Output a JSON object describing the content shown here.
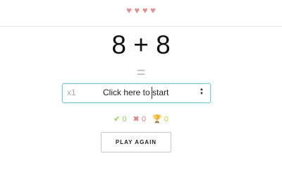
{
  "header": {
    "lives": {
      "count": 4,
      "icon": "heart-icon",
      "color": "#e88d8d"
    }
  },
  "problem": {
    "left": "8",
    "operator": "+",
    "right": "8",
    "equals": "="
  },
  "answer": {
    "multiplier": "x1",
    "start_text": "Click here to start"
  },
  "stats": {
    "correct_count": "0",
    "correct_icon": "check-icon",
    "correct_color": "#8fd14f",
    "wrong_count": "0",
    "wrong_icon": "x-icon",
    "wrong_color": "#e37f7f",
    "streak_count": "0",
    "streak_icon": "trophy-icon",
    "streak_color": "#e7c62f"
  },
  "actions": {
    "play_again": "PLAY AGAIN"
  }
}
